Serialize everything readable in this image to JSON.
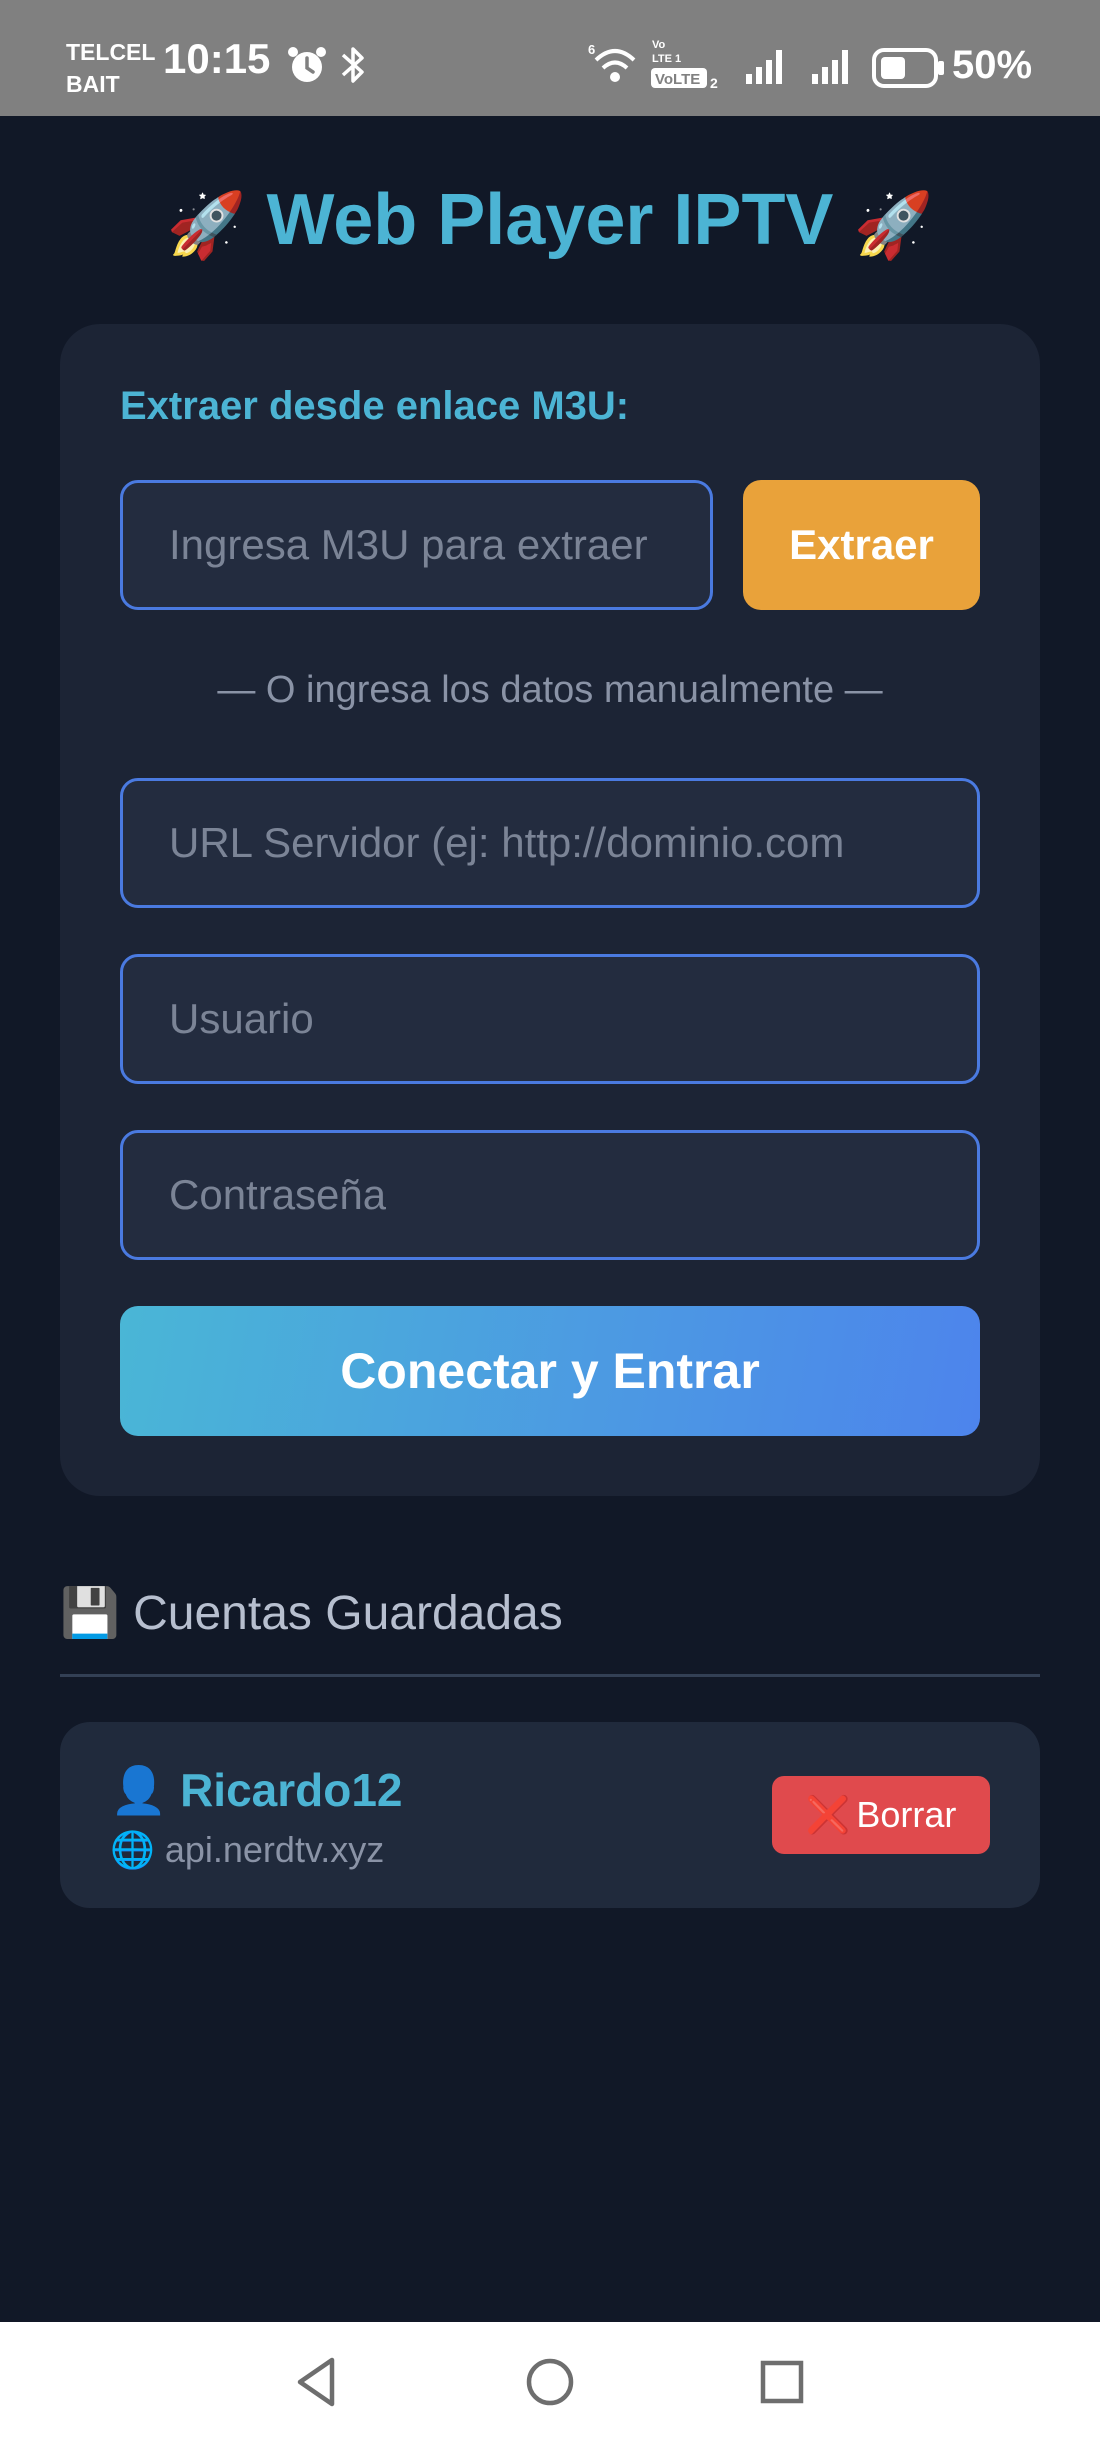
{
  "status_bar": {
    "carrier_line1": "TELCEL",
    "carrier_line2": "BAIT",
    "time": "10:15",
    "battery": "50%",
    "icons": [
      "alarm-icon",
      "bluetooth-icon",
      "wifi-icon",
      "volte-icon",
      "signal-icon",
      "signal-icon",
      "battery-icon"
    ]
  },
  "header": {
    "title": "Web Player IPTV",
    "emoji_left": "🚀",
    "emoji_right": "🚀"
  },
  "form": {
    "m3u_label": "Extraer desde enlace M3U:",
    "m3u_placeholder": "Ingresa M3U para extraer",
    "extract_button": "Extraer",
    "divider": "— O ingresa los datos manualmente —",
    "server_placeholder": "URL Servidor (ej: http://dominio.com",
    "user_placeholder": "Usuario",
    "password_placeholder": "Contraseña",
    "connect_button": "Conectar y Entrar"
  },
  "saved": {
    "icon": "💾",
    "title": "Cuentas Guardadas",
    "accounts": [
      {
        "user_icon": "👤",
        "name": "Ricardo12",
        "server_icon": "🌐",
        "server": "api.nerdtv.xyz",
        "delete_icon": "❌",
        "delete_label": "Borrar"
      }
    ]
  },
  "colors": {
    "background": "#111827",
    "card": "#1c2435",
    "accent": "#4cb4d4",
    "extract": "#e9a23a",
    "delete": "#e04a4d"
  }
}
